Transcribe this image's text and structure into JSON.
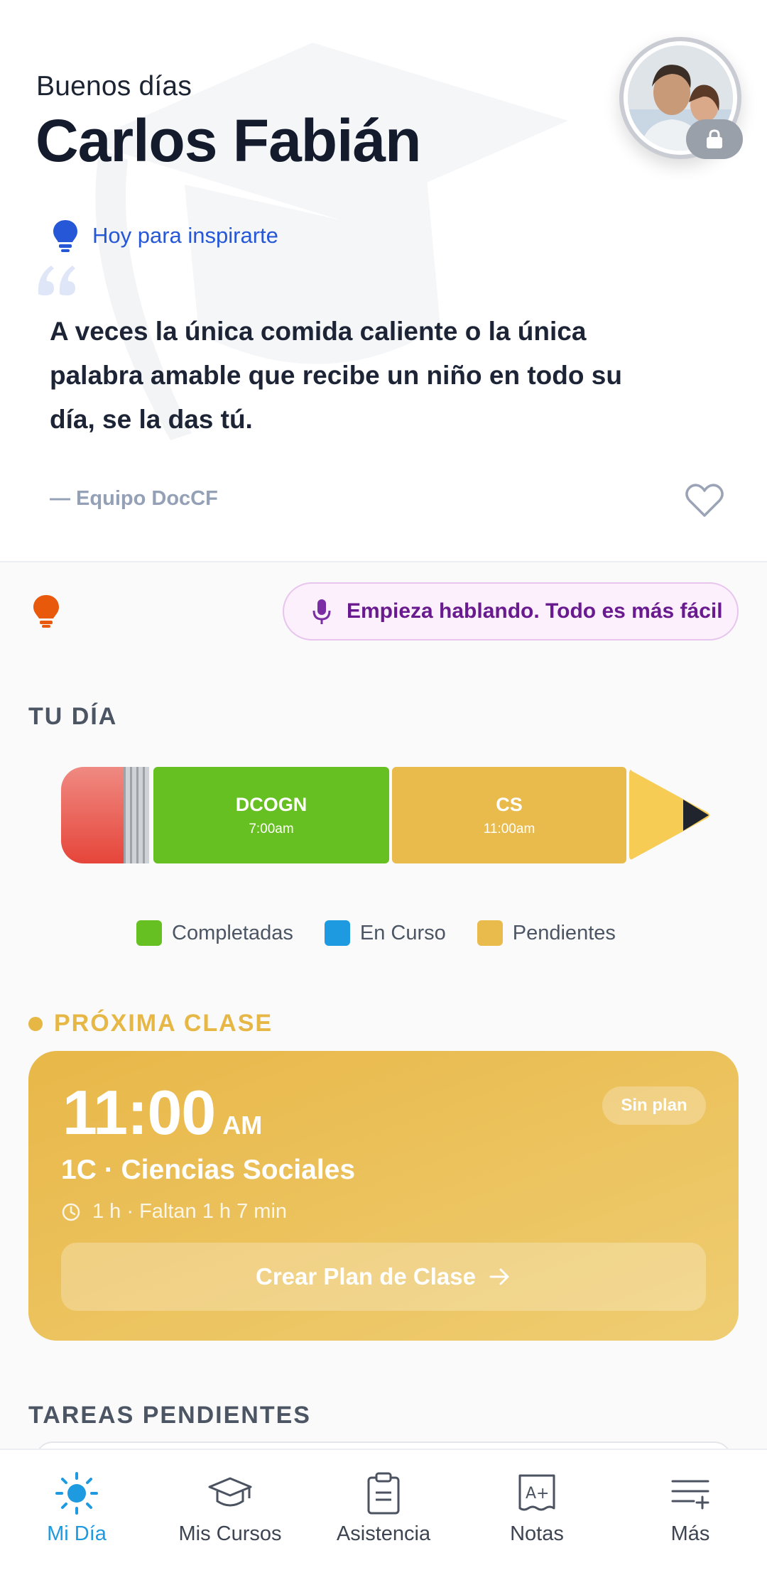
{
  "header": {
    "greeting": "Buenos días",
    "user_name": "Carlos Fabián"
  },
  "inspiration": {
    "label": "Hoy para inspirarte",
    "quote": "A veces la única comida caliente o la única palabra amable que recibe un niño en todo su día, se la das tú.",
    "author": "— Equipo DocCF"
  },
  "voice": {
    "label": "Empieza hablando. Todo es más fácil"
  },
  "tu_dia": {
    "title": "TU DÍA",
    "classes": [
      {
        "code": "DCOGN",
        "time": "7:00am",
        "status": "completed"
      },
      {
        "code": "CS",
        "time": "11:00am",
        "status": "pending"
      }
    ],
    "legend": [
      {
        "label": "Completadas",
        "color": "#67c022"
      },
      {
        "label": "En Curso",
        "color": "#1e9ae0"
      },
      {
        "label": "Pendientes",
        "color": "#e9bb4c"
      }
    ]
  },
  "next_class": {
    "title": "PRÓXIMA CLASE",
    "time": "11:00",
    "ampm": "AM",
    "badge": "Sin plan",
    "name": "1C · Ciencias Sociales",
    "duration": "1 h · Faltan 1 h 7 min",
    "action": "Crear Plan de Clase"
  },
  "pending_tasks": {
    "title": "TAREAS PENDIENTES"
  },
  "nav": {
    "items": [
      {
        "label": "Mi Día",
        "icon": "sun-icon",
        "active": true
      },
      {
        "label": "Mis Cursos",
        "icon": "graduation-cap-icon",
        "active": false
      },
      {
        "label": "Asistencia",
        "icon": "clipboard-icon",
        "active": false
      },
      {
        "label": "Notas",
        "icon": "grade-icon",
        "active": false
      },
      {
        "label": "Más",
        "icon": "menu-plus-icon",
        "active": false
      }
    ]
  },
  "colors": {
    "accent_blue": "#2557d6",
    "nav_active": "#1e9ae0",
    "next_class_bg": "#e8b748",
    "voice_text": "#6a1a8f"
  }
}
